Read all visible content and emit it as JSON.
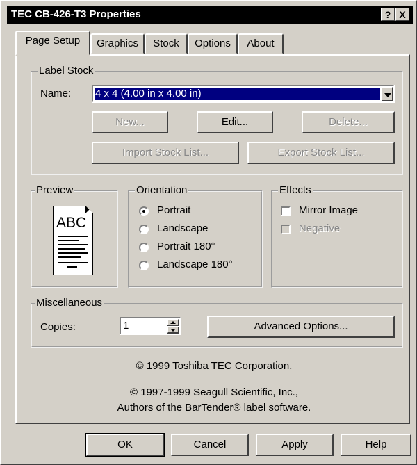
{
  "window": {
    "title": "TEC CB-426-T3 Properties",
    "help_label": "?",
    "close_label": "X"
  },
  "tabs": [
    {
      "label": "Page Setup",
      "active": true
    },
    {
      "label": "Graphics"
    },
    {
      "label": "Stock"
    },
    {
      "label": "Options"
    },
    {
      "label": "About"
    }
  ],
  "label_stock": {
    "legend": "Label Stock",
    "name_label": "Name:",
    "name_value": "4 x 4 (4.00 in x 4.00 in)",
    "new_label": "New...",
    "edit_label": "Edit...",
    "delete_label": "Delete...",
    "import_label": "Import Stock List...",
    "export_label": "Export Stock List..."
  },
  "preview": {
    "legend": "Preview",
    "sample_text": "ABC"
  },
  "orientation": {
    "legend": "Orientation",
    "options": [
      "Portrait",
      "Landscape",
      "Portrait 180°",
      "Landscape 180°"
    ],
    "selected": "Portrait"
  },
  "effects": {
    "legend": "Effects",
    "mirror_label": "Mirror Image",
    "negative_label": "Negative"
  },
  "misc": {
    "legend": "Miscellaneous",
    "copies_label": "Copies:",
    "copies_value": "1",
    "advanced_label": "Advanced Options..."
  },
  "credits": {
    "line1": "© 1999 Toshiba TEC Corporation.",
    "line2": "© 1997-1999 Seagull Scientific, Inc.,",
    "line3": "Authors of the BarTender® label software."
  },
  "footer": {
    "ok_label": "OK",
    "cancel_label": "Cancel",
    "apply_label": "Apply",
    "help_label": "Help"
  }
}
